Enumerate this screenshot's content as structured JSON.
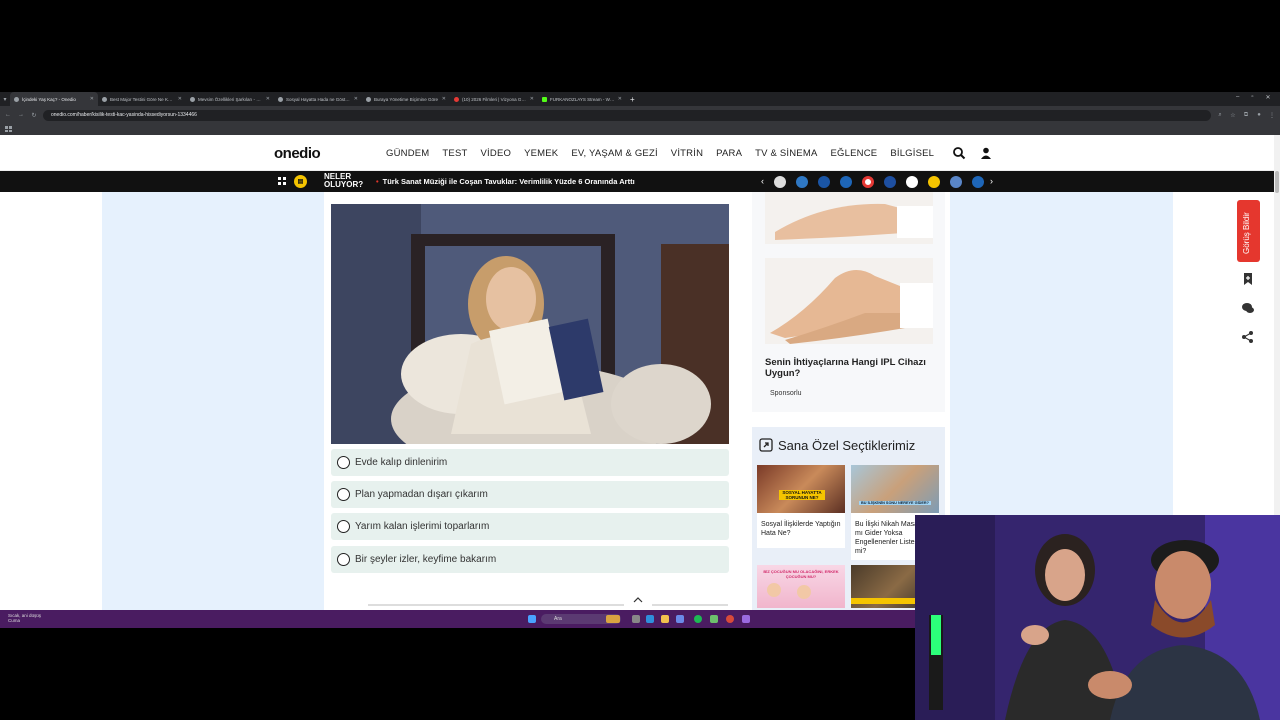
{
  "browser": {
    "tabs": [
      {
        "title": "İçindeki Yaş Kaç? - Onedio",
        "active": true
      },
      {
        "title": "Best Major Testini Göre Ne Kadar",
        "active": false
      },
      {
        "title": "Mevsim Özellikleri Şarkıları - Onedio",
        "active": false
      },
      {
        "title": "Sosyal Hayatta Hada ne Gösteriyor",
        "active": false
      },
      {
        "title": "Buraya Yönetime Biçimine Göre",
        "active": false
      },
      {
        "title": "(10) 2026 Filmleri | Vizyona Giriş",
        "active": false
      },
      {
        "title": "FURKANOZLAYS Stream - Web",
        "active": false
      }
    ],
    "new_tab": "+",
    "url": "onedio.com/haber/kisilik-testi-kac-yasinda-hissediyorsun-1334466"
  },
  "site": {
    "logo": "onedio",
    "nav": [
      "GÜNDEM",
      "TEST",
      "VİDEO",
      "YEMEK",
      "EV, YAŞAM & GEZİ",
      "VİTRİN",
      "PARA",
      "TV & SİNEMA",
      "EĞLENCE",
      "BİLGİSEL"
    ],
    "ticker_label": "NELER OLUYOR?",
    "ticker_headline": "Türk Sanat Müziği ile Coşan Tavuklar: Verimlilik Yüzde 6 Oranında Arttı",
    "quiz_options": [
      "Evde kalıp dinlenirim",
      "Plan yapmadan dışarı çıkarım",
      "Yarım kalan işlerimi toparlarım",
      "Bir şeyler izler, keyfime bakarım"
    ],
    "ad_title": "Senin İhtiyaçlarına Hangi IPL Cihazı Uygun?",
    "ad_sponsored": "Sponsorlu",
    "picks_title": "Sana Özel Seçtiklerimiz",
    "picks": [
      {
        "text": "Sosyal İlişkilerde Yaptığın Hata Ne?",
        "overlay": "SOSYAL HAYATTA SORUNUN NE?"
      },
      {
        "text": "Bu İlişki Nikah Masasına mı Gider Yoksa Engellenenler Listesine mi?",
        "overlay": "BU İLİŞKİNİN SONU NEREYE GİDER?"
      },
      {
        "text": "",
        "overlay": "BİZ ÇOCUĞUN MU OLACAĞINI, ERKEK ÇOCUĞUN MU?"
      },
      {
        "text": "",
        "overlay": ""
      }
    ],
    "feedback": "Görüş Bildir"
  },
  "taskbar": {
    "left_line1": "Sıcak, ani düşüş",
    "left_line2": "Cuma",
    "search": "Ara"
  },
  "colors": {
    "accent_red": "#e5372e",
    "ticker_yellow": "#f5c400",
    "page_bg_blue": "#e6f1fd",
    "option_bg": "#e7f1ee",
    "taskbar": "#4a1c61"
  }
}
